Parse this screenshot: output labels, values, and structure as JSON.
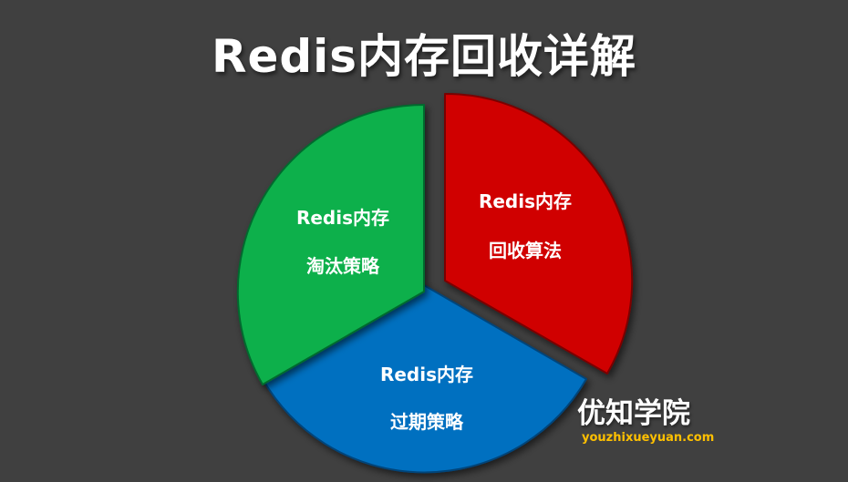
{
  "title": "Redis内存回收详解",
  "segments": [
    {
      "id": "red",
      "line1": "Redis内存",
      "line2": "回收算法",
      "color": "#d00000",
      "stroke": "#7a0000"
    },
    {
      "id": "blue",
      "line1": "Redis内存",
      "line2": "过期策略",
      "color": "#0070c0",
      "stroke": "#00447a"
    },
    {
      "id": "green",
      "line1": "Redis内存",
      "line2": "淘汰策略",
      "color": "#0bb04c",
      "stroke": "#066b2e"
    }
  ],
  "brand": {
    "name": "优知学院",
    "url": "youzhixueyuan.com",
    "url_color": "#ffc000"
  }
}
